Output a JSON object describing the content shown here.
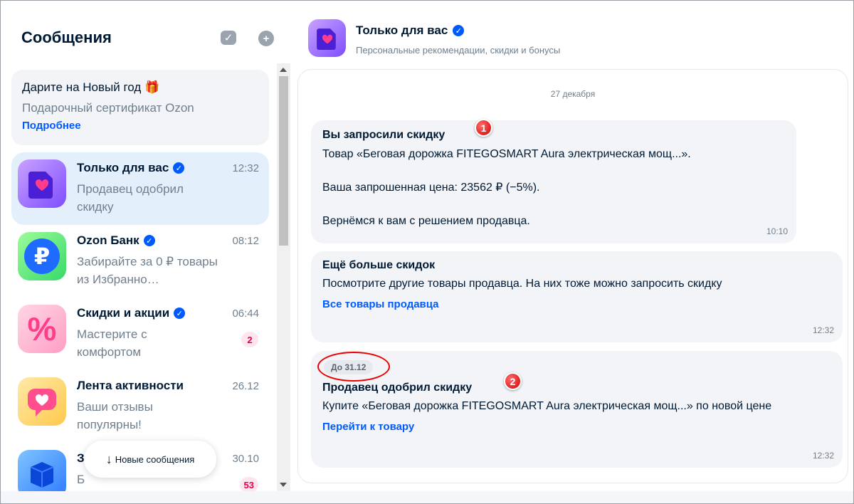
{
  "sidebar": {
    "title": "Сообщения",
    "promo": {
      "title": "Дарите на Новый год",
      "subtitle": "Подарочный сертификат Ozon",
      "link": "Подробнее"
    },
    "chats": [
      {
        "name": "Только для вас",
        "time": "12:32",
        "preview": "Продавец одобрил скидку",
        "verified": true,
        "badge": ""
      },
      {
        "name": "Ozon Банк",
        "time": "08:12",
        "preview": "Забирайте за 0 ₽ товары из Избранно…",
        "verified": true,
        "badge": ""
      },
      {
        "name": "Скидки и акции",
        "time": "06:44",
        "preview": "Мастерите с комфортом",
        "verified": true,
        "badge": "2"
      },
      {
        "name": "Лента активности",
        "time": "26.12",
        "preview": "Ваши отзывы популярны!",
        "verified": false,
        "badge": ""
      },
      {
        "name": "З",
        "time": "30.10",
        "preview": "Б заказ?",
        "verified": false,
        "badge": "53"
      }
    ],
    "new_messages_label": "Новые сообщения"
  },
  "conversation": {
    "title": "Только для вас",
    "subtitle": "Персональные рекомендации, скидки и бонусы",
    "date": "27 декабря",
    "messages": [
      {
        "title": "Вы запросили скидку",
        "line1": "Товар «Беговая дорожка FITEGOSMART Aura электрическая мощ...».",
        "line2": "Ваша запрошенная цена: 23562 ₽ (−5%).",
        "line3": "Вернёмся к вам с решением продавца.",
        "time": "10:10",
        "marker": "1"
      },
      {
        "title": "Ещё больше скидок",
        "text": "Посмотрите другие товары продавца. На них тоже можно запросить скидку",
        "link": "Все товары продавца",
        "time": "12:32"
      },
      {
        "deadline": "До 31.12",
        "title": "Продавец одобрил скидку",
        "text": "Купите «Беговая дорожка FITEGOSMART Aura электрическая мощ...» по новой цене",
        "link": "Перейти к товару",
        "time": "12:32",
        "marker": "2"
      }
    ]
  },
  "colors": {
    "accent": "#005bff",
    "badge": "#e6004c",
    "annotation": "#e00000"
  }
}
